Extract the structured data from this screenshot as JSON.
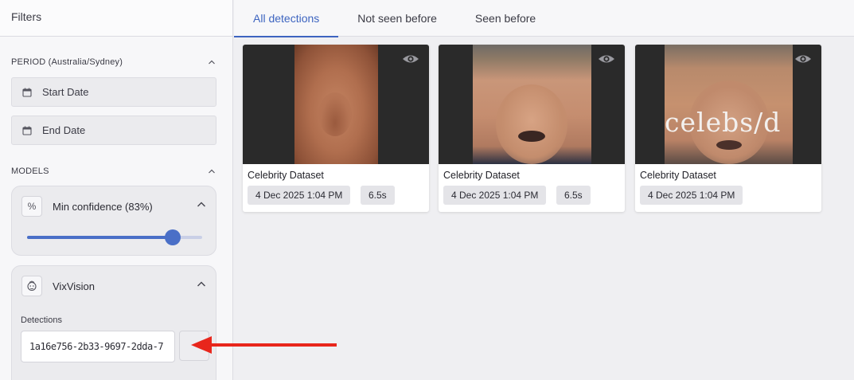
{
  "sidebar": {
    "title": "Filters",
    "period": {
      "label": "PERIOD (Australia/Sydney)",
      "start_placeholder": "Start Date",
      "end_placeholder": "End Date",
      "icon": "calendar-icon"
    },
    "models": {
      "label": "MODELS",
      "confidence": {
        "title": "Min confidence (83%)",
        "icon_glyph": "%",
        "value": 0.83
      },
      "vixvision": {
        "title": "VixVision",
        "icon": "face-scan-icon",
        "detections_label": "Detections",
        "detections_value": "1a16e756-2b33-9697-2dda-7"
      }
    }
  },
  "tabs": [
    {
      "label": "All detections",
      "active": true
    },
    {
      "label": "Not seen before",
      "active": false
    },
    {
      "label": "Seen before",
      "active": false
    }
  ],
  "cards": [
    {
      "name": "Celebrity Dataset",
      "date": "4 Dec 2025 1:04 PM",
      "duration": "6.5s"
    },
    {
      "name": "Celebrity Dataset",
      "date": "4 Dec 2025 1:04 PM",
      "duration": "6.5s"
    },
    {
      "name": "Celebrity Dataset",
      "date": "4 Dec 2025 1:04 PM",
      "duration": "",
      "overlay_text": "celebs/d"
    }
  ],
  "colors": {
    "accent": "#3d64c0",
    "slider": "#4a6fc7",
    "annotation_arrow": "#e8261c"
  }
}
